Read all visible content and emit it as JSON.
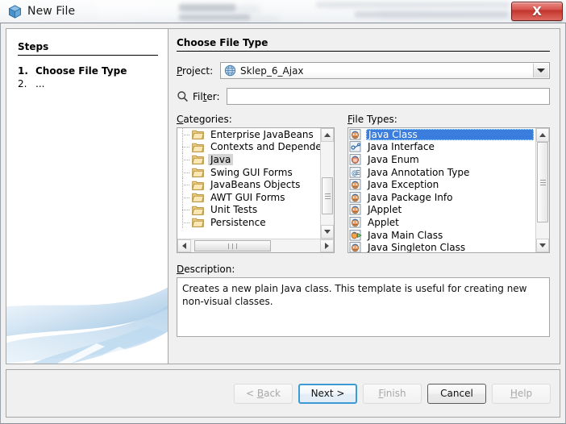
{
  "window": {
    "title": "New File",
    "app_icon": "cube-icon",
    "close_label": "X"
  },
  "steps_panel": {
    "heading": "Steps",
    "items": [
      {
        "number": "1.",
        "label": "Choose File Type",
        "current": true
      },
      {
        "number": "2.",
        "label": "...",
        "current": false
      }
    ]
  },
  "main": {
    "heading": "Choose File Type",
    "project": {
      "label": "Project:",
      "icon": "globe-icon",
      "value": "Sklep_6_Ajax",
      "arrow_icon": "chevron-down-icon"
    },
    "filter": {
      "icon": "search-icon",
      "label": "Filter:",
      "value": "",
      "placeholder": ""
    },
    "categories": {
      "caption": "Categories:",
      "items": [
        {
          "label": "Enterprise JavaBeans",
          "selected": false
        },
        {
          "label": "Contexts and Depende",
          "selected": false
        },
        {
          "label": "Java",
          "selected": true
        },
        {
          "label": "Swing GUI Forms",
          "selected": false
        },
        {
          "label": "JavaBeans Objects",
          "selected": false
        },
        {
          "label": "AWT GUI Forms",
          "selected": false
        },
        {
          "label": "Unit Tests",
          "selected": false
        },
        {
          "label": "Persistence",
          "selected": false
        }
      ]
    },
    "file_types": {
      "caption": "File Types:",
      "items": [
        {
          "label": "Java Class",
          "selected": true,
          "icon": "java-class-icon"
        },
        {
          "label": "Java Interface",
          "selected": false,
          "icon": "java-interface-icon"
        },
        {
          "label": "Java Enum",
          "selected": false,
          "icon": "java-enum-icon"
        },
        {
          "label": "Java Annotation Type",
          "selected": false,
          "icon": "java-annotation-icon"
        },
        {
          "label": "Java Exception",
          "selected": false,
          "icon": "java-class-icon"
        },
        {
          "label": "Java Package Info",
          "selected": false,
          "icon": "java-class-icon"
        },
        {
          "label": "JApplet",
          "selected": false,
          "icon": "java-class-icon"
        },
        {
          "label": "Applet",
          "selected": false,
          "icon": "java-class-icon"
        },
        {
          "label": "Java Main Class",
          "selected": false,
          "icon": "java-main-class-icon"
        },
        {
          "label": "Java Singleton Class",
          "selected": false,
          "icon": "java-class-icon"
        }
      ]
    },
    "description": {
      "caption": "Description:",
      "text": "Creates a new plain Java class. This template is useful for creating new non-visual classes."
    }
  },
  "buttons": [
    {
      "id": "back",
      "label": "< Back",
      "mnemonic": "B",
      "state": "disabled"
    },
    {
      "id": "next",
      "label": "Next >",
      "mnemonic": "",
      "state": "default"
    },
    {
      "id": "finish",
      "label": "Finish",
      "mnemonic": "F",
      "state": "disabled"
    },
    {
      "id": "cancel",
      "label": "Cancel",
      "mnemonic": "",
      "state": "enabled"
    },
    {
      "id": "help",
      "label": "Help",
      "mnemonic": "H",
      "state": "disabled"
    }
  ],
  "colors": {
    "selection_blue": "#3a7ddd",
    "category_selection": "#d4d4d4",
    "dialog_bg": "#f0f0f0",
    "close_red": "#c0332b",
    "default_button_border": "#3c9ad6"
  }
}
